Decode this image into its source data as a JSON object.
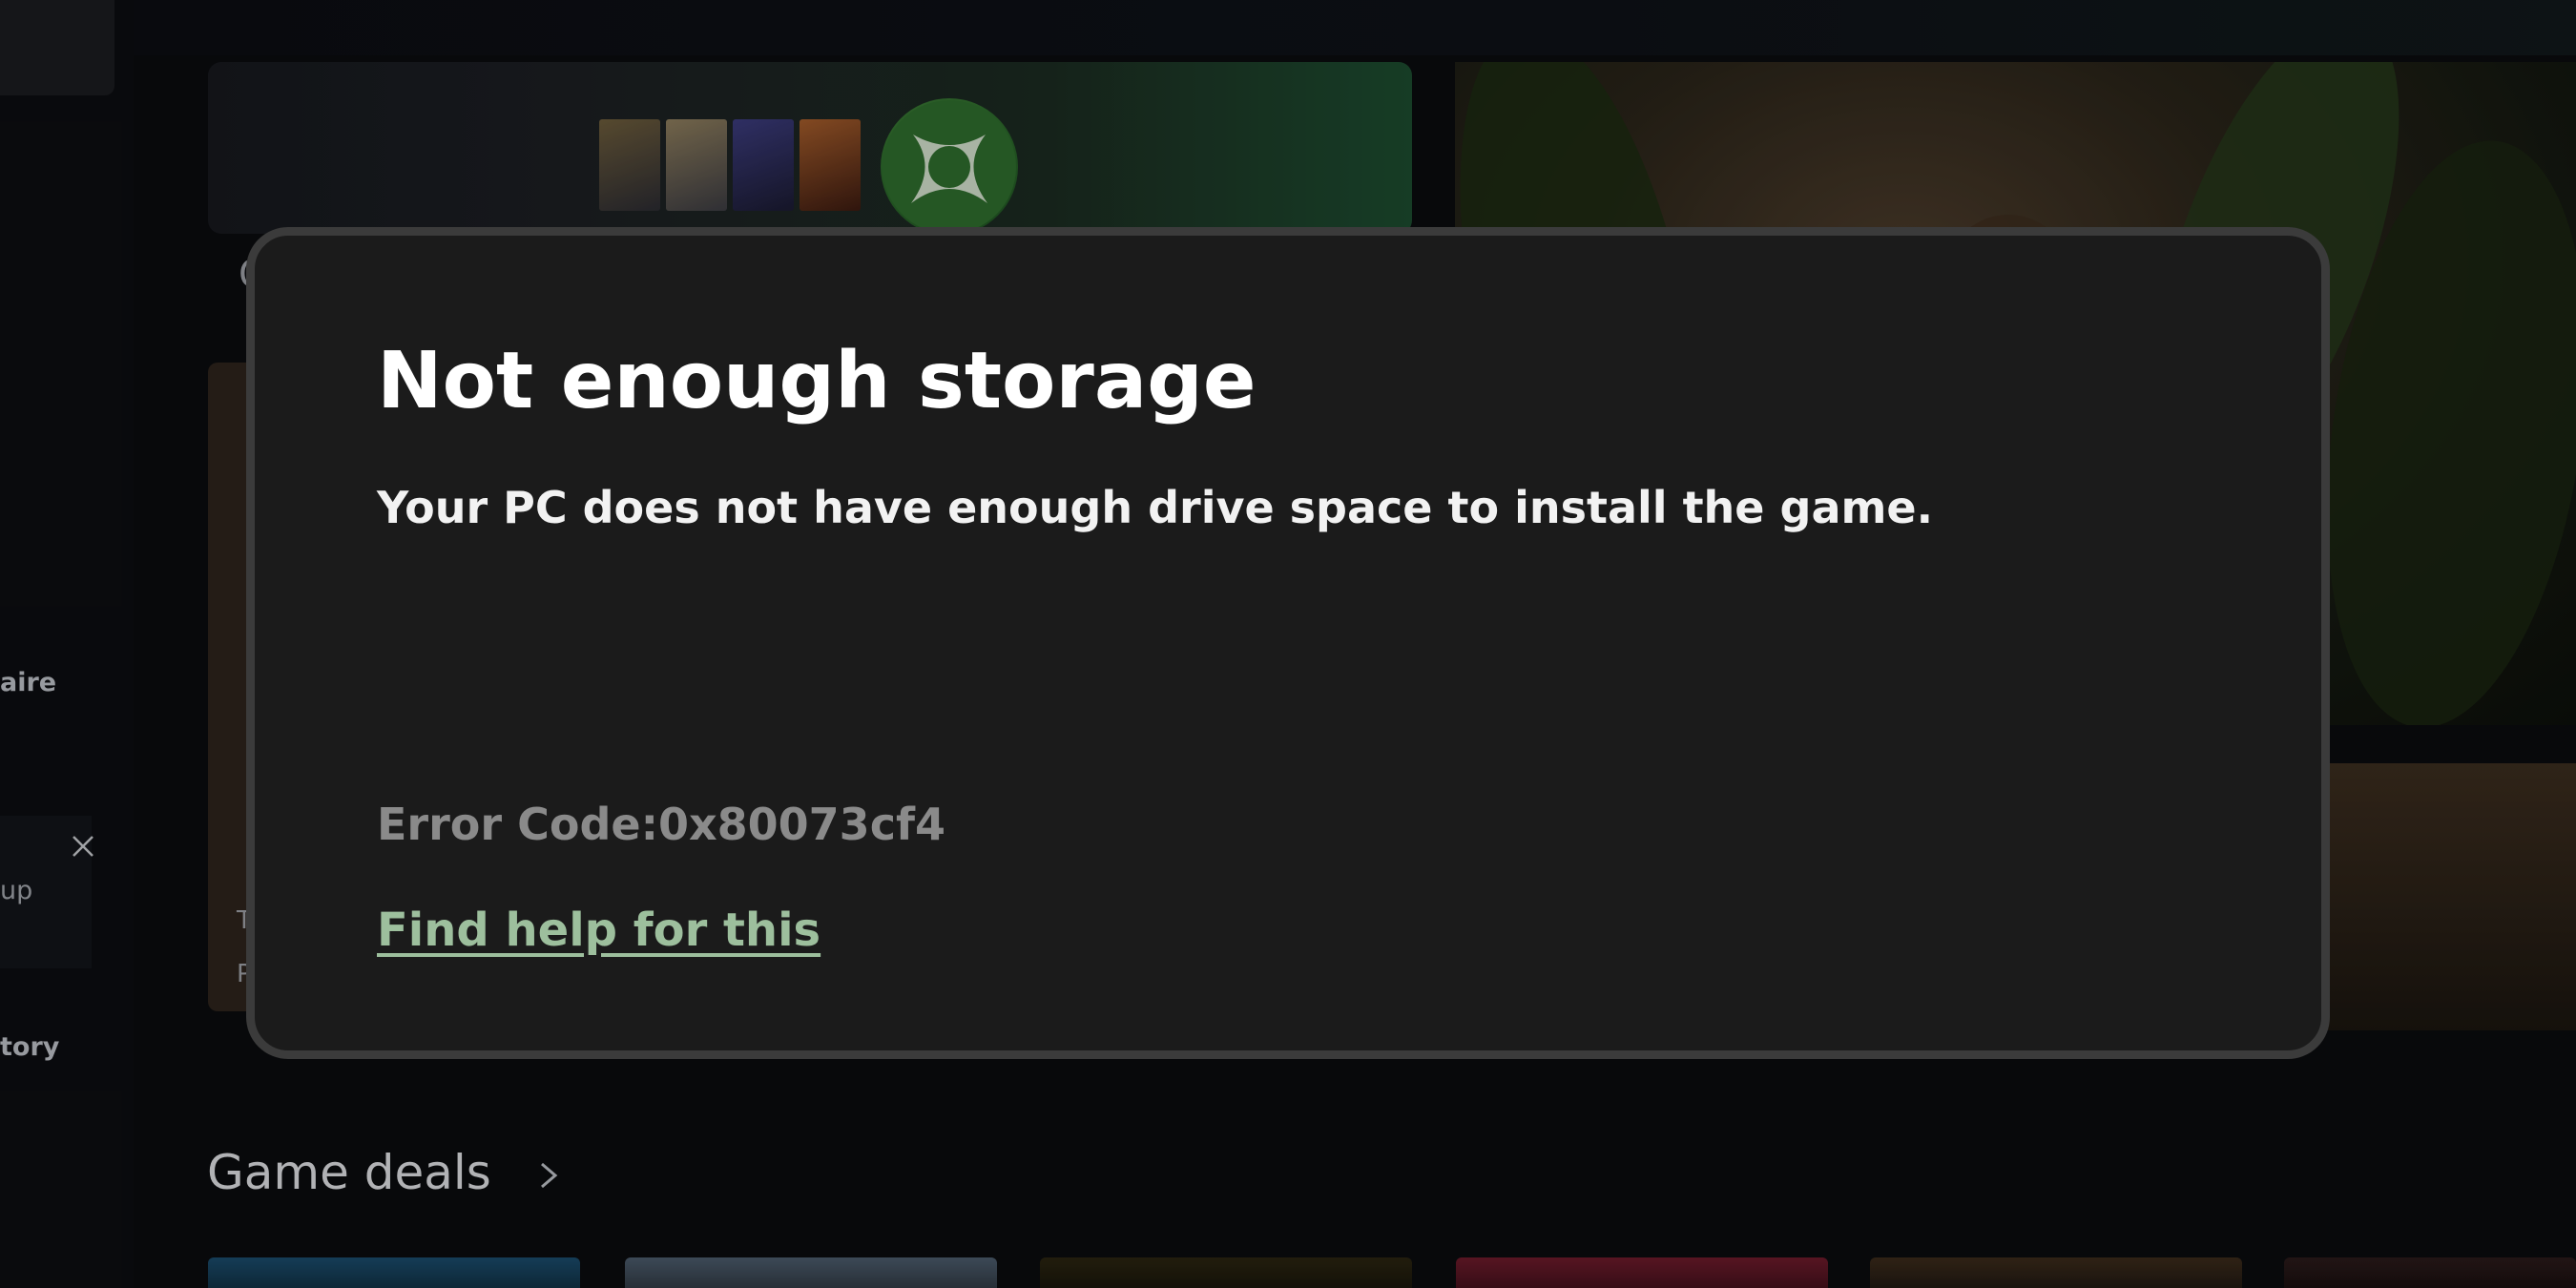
{
  "sidebar": {
    "partial_labels": [
      "aire",
      "up",
      "tory"
    ]
  },
  "background": {
    "partial_heading": "G",
    "partial_card_title": "T",
    "partial_card_sub": "P",
    "section_title": "Game deals"
  },
  "dialog": {
    "title": "Not enough storage",
    "message": "Your PC does not have enough drive space to install the game.",
    "error_code": "Error Code:0x80073cf4",
    "help_link": "Find help for this"
  },
  "colors": {
    "dialog_bg": "#1b1b1b",
    "dialog_border": "#3b3b3b",
    "help_link": "#9dbf9d",
    "error_code": "#8a8a8a"
  },
  "icons": {
    "close": "close-icon",
    "chevron": "chevron-right-icon",
    "xbox": "xbox-logo-icon"
  }
}
